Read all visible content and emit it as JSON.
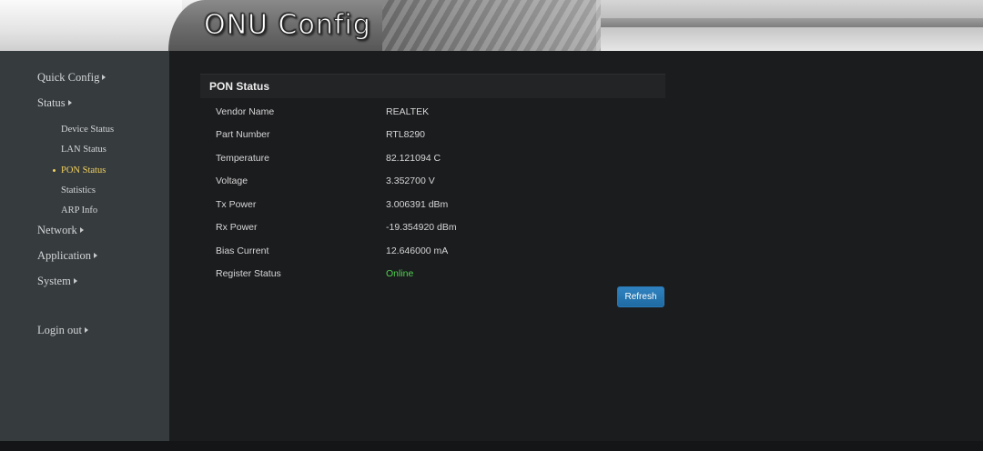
{
  "header": {
    "title": "ONU Config"
  },
  "sidebar": {
    "items": [
      {
        "label": "Quick Config"
      },
      {
        "label": "Status"
      },
      {
        "label": "Network"
      },
      {
        "label": "Application"
      },
      {
        "label": "System"
      },
      {
        "label": "Login out"
      }
    ],
    "status_subitems": [
      {
        "label": "Device Status"
      },
      {
        "label": "LAN Status"
      },
      {
        "label": "PON Status",
        "active": true
      },
      {
        "label": "Statistics"
      },
      {
        "label": "ARP Info"
      }
    ]
  },
  "main": {
    "title": "PON Status",
    "rows": [
      {
        "label": "Vendor Name",
        "value": "REALTEK"
      },
      {
        "label": "Part Number",
        "value": "RTL8290"
      },
      {
        "label": "Temperature",
        "value": "82.121094 C"
      },
      {
        "label": "Voltage",
        "value": "3.352700 V"
      },
      {
        "label": "Tx Power",
        "value": "3.006391 dBm"
      },
      {
        "label": "Rx Power",
        "value": "-19.354920 dBm"
      },
      {
        "label": "Bias Current",
        "value": "12.646000 mA"
      },
      {
        "label": "Register Status",
        "value": "Online"
      }
    ],
    "refresh_label": "Refresh"
  },
  "colors": {
    "online": "#4fd14f",
    "active_nav": "#f2d15e",
    "button": "#1f6aa3"
  }
}
